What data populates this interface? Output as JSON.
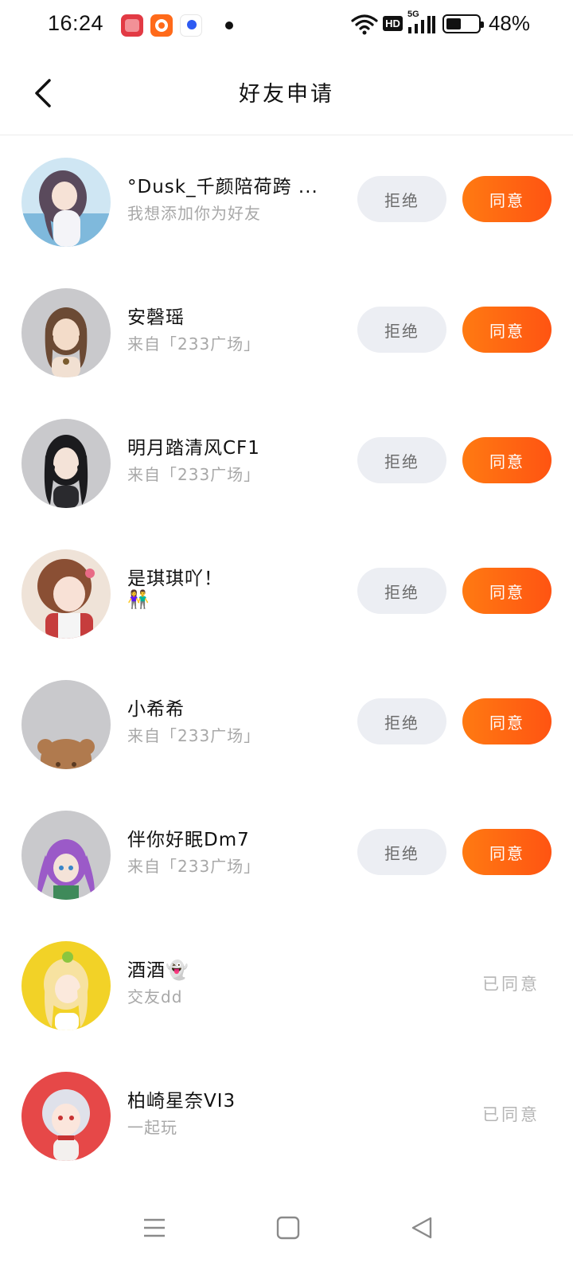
{
  "status_bar": {
    "time": "16:24",
    "battery_percent": "48%",
    "battery_level": 0.48,
    "network": "5G",
    "hd_label": "HD",
    "app_icons": [
      "xiaohongshu-icon",
      "kuaishou-icon",
      "baidu-icon"
    ]
  },
  "header": {
    "title": "好友申请"
  },
  "requests": [
    {
      "name": "°Dusk_千颜陪荷跨 ...",
      "message": "我想添加你为好友",
      "status": "pending"
    },
    {
      "name": "安磬瑶",
      "message": "来自「233广场」",
      "status": "pending"
    },
    {
      "name": "明月踏清风CF1",
      "message": "来自「233广场」",
      "status": "pending"
    },
    {
      "name": "是琪琪吖！",
      "message": "👫",
      "status": "pending"
    },
    {
      "name": "小希希",
      "message": "来自「233广场」",
      "status": "pending"
    },
    {
      "name": "伴你好眠Dm7",
      "message": "来自「233广场」",
      "status": "pending"
    },
    {
      "name": "酒酒👻",
      "message": "交友dd",
      "status": "accepted"
    },
    {
      "name": "柏崎星奈VI3",
      "message": "一起玩",
      "status": "accepted"
    }
  ],
  "actions": {
    "reject_label": "拒绝",
    "accept_label": "同意",
    "accepted_label": "已同意"
  },
  "colors": {
    "accent": "#ff6a14",
    "reject_bg": "#eceef3",
    "secondary_text": "#a8a8a8"
  }
}
